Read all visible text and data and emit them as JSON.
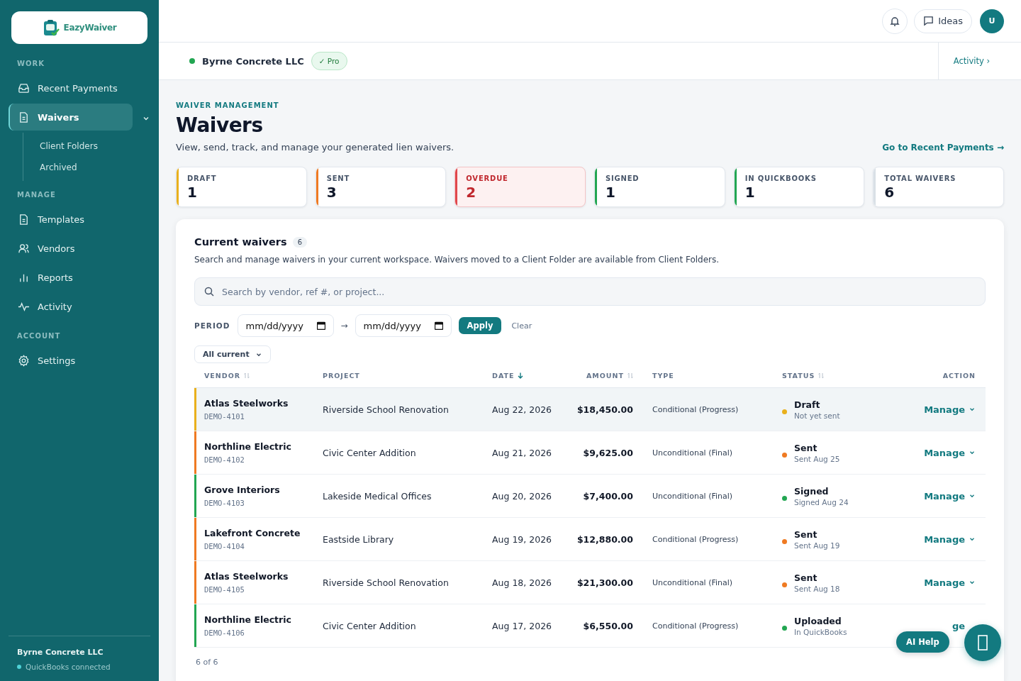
{
  "brand": {
    "name": "EazyWaiver"
  },
  "sidebar": {
    "sections": [
      {
        "title": "WORK",
        "items": [
          {
            "label": "Recent Payments",
            "selected": false
          },
          {
            "label": "Waivers",
            "selected": true,
            "expanded": true,
            "children": [
              {
                "label": "Client Folders",
                "selected": false
              },
              {
                "label": "Archived",
                "selected": false
              }
            ]
          }
        ]
      },
      {
        "title": "MANAGE",
        "items": [
          {
            "label": "Templates",
            "selected": false
          },
          {
            "label": "Vendors",
            "selected": false
          },
          {
            "label": "Reports",
            "selected": false
          },
          {
            "label": "Activity",
            "selected": false
          }
        ]
      },
      {
        "title": "ACCOUNT",
        "items": [
          {
            "label": "Settings",
            "selected": false
          }
        ]
      }
    ],
    "footer": {
      "company": "Byrne Concrete LLC",
      "status": "QuickBooks connected",
      "connected": true
    }
  },
  "topbar": {
    "ideas": "Ideas",
    "avatar": "U"
  },
  "subheader": {
    "company": "Byrne Concrete LLC",
    "online": true,
    "plan": "✓ Pro",
    "link": "Activity ›"
  },
  "page": {
    "eyebrow": "WAIVER MANAGEMENT",
    "title": "Waivers",
    "subtitle": "View, send, track, and manage your generated lien waivers.",
    "link": "Go to Recent Payments →"
  },
  "stats": [
    {
      "label": "DRAFT",
      "value": "1",
      "color": "#e9b01c",
      "alert": false
    },
    {
      "label": "SENT",
      "value": "3",
      "color": "#ef7a22",
      "alert": false
    },
    {
      "label": "OVERDUE",
      "value": "2",
      "color": "#e0474c",
      "alert": true
    },
    {
      "label": "SIGNED",
      "value": "1",
      "color": "#22a652",
      "alert": false
    },
    {
      "label": "IN QUICKBOOKS",
      "value": "1",
      "color": "#22a652",
      "alert": false
    },
    {
      "label": "TOTAL WAIVERS",
      "value": "6",
      "color": "#d9e0e6",
      "alert": false
    }
  ],
  "panel": {
    "title": "Current waivers",
    "count": "6",
    "description": "Search and manage waivers in your current workspace. Waivers moved to a Client Folder are available from Client Folders.",
    "search": {
      "placeholder": "Search by vendor, ref #, or project..."
    },
    "period": {
      "label": "PERIOD",
      "dates": [
        {
          "placeholder": "mm/dd/yyyy"
        },
        {
          "placeholder": "mm/dd/yyyy"
        }
      ],
      "arrow": "→",
      "apply": "Apply",
      "clear": "Clear"
    },
    "filter": "All current",
    "columns": [
      {
        "label": "VENDOR",
        "sortable": true,
        "sorted": false
      },
      {
        "label": "PROJECT",
        "sortable": false,
        "sorted": false
      },
      {
        "label": "DATE",
        "sortable": true,
        "sorted": true
      },
      {
        "label": "AMOUNT",
        "sortable": true,
        "sorted": false
      },
      {
        "label": "TYPE",
        "sortable": false,
        "sorted": false
      },
      {
        "label": "STATUS",
        "sortable": true,
        "sorted": false
      },
      {
        "label": "ACTION",
        "sortable": false,
        "sorted": false
      }
    ],
    "rows": [
      {
        "vendor": "Atlas Steelworks",
        "ref": "DEMO-4101",
        "project": "Riverside School Renovation",
        "date": "Aug 22, 2026",
        "amount": "$18,450.00",
        "type": "Conditional (Progress)",
        "status": "Draft",
        "status_note": "Not yet sent",
        "color": "#e9b01c",
        "selected": true,
        "action": "Manage",
        "caret": true
      },
      {
        "vendor": "Northline Electric",
        "ref": "DEMO-4102",
        "project": "Civic Center Addition",
        "date": "Aug 21, 2026",
        "amount": "$9,625.00",
        "type": "Unconditional (Final)",
        "status": "Sent",
        "status_note": "Sent Aug 25",
        "color": "#ef7a22",
        "selected": false,
        "action": "Manage",
        "caret": true
      },
      {
        "vendor": "Grove Interiors",
        "ref": "DEMO-4103",
        "project": "Lakeside Medical Offices",
        "date": "Aug 20, 2026",
        "amount": "$7,400.00",
        "type": "Unconditional (Final)",
        "status": "Signed",
        "status_note": "Signed Aug 24",
        "color": "#22a652",
        "selected": false,
        "action": "Manage",
        "caret": true
      },
      {
        "vendor": "Lakefront Concrete",
        "ref": "DEMO-4104",
        "project": "Eastside Library",
        "date": "Aug 19, 2026",
        "amount": "$12,880.00",
        "type": "Conditional (Progress)",
        "status": "Sent",
        "status_note": "Sent Aug 19",
        "color": "#ef7a22",
        "selected": false,
        "action": "Manage",
        "caret": true
      },
      {
        "vendor": "Atlas Steelworks",
        "ref": "DEMO-4105",
        "project": "Riverside School Renovation",
        "date": "Aug 18, 2026",
        "amount": "$21,300.00",
        "type": "Unconditional (Final)",
        "status": "Sent",
        "status_note": "Sent Aug 18",
        "color": "#ef7a22",
        "selected": false,
        "action": "Manage",
        "caret": true
      },
      {
        "vendor": "Northline Electric",
        "ref": "DEMO-4106",
        "project": "Civic Center Addition",
        "date": "Aug 17, 2026",
        "amount": "$6,550.00",
        "type": "Conditional (Progress)",
        "status": "Uploaded",
        "status_note": "In QuickBooks",
        "color": "#22a652",
        "selected": false,
        "action": "ge",
        "caret": false
      }
    ],
    "footer": "6 of 6"
  },
  "floating": {
    "help": "AI Help"
  }
}
